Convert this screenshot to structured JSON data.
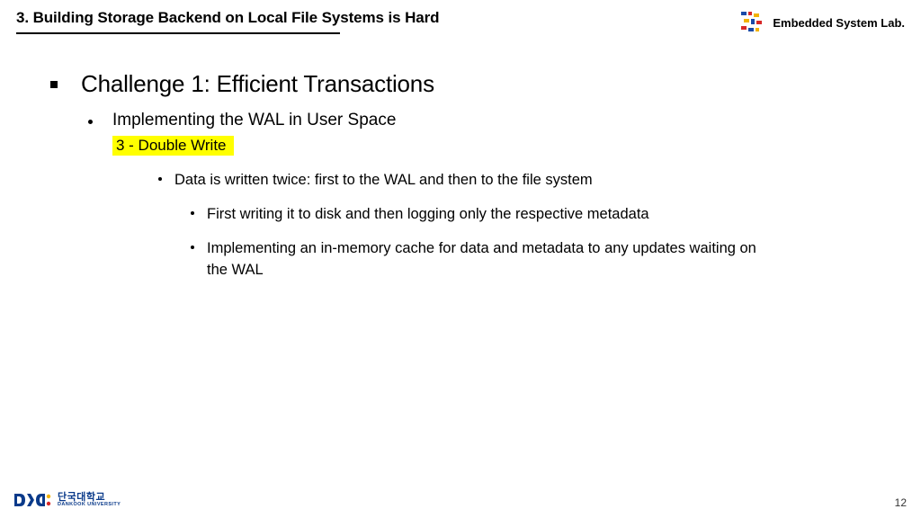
{
  "header": {
    "section_title": "3. Building Storage Backend on Local File Systems is Hard",
    "lab_name": "Embedded System Lab."
  },
  "content": {
    "h1": "Challenge 1: Efficient Transactions",
    "h2": "Implementing the WAL in User Space",
    "highlight": "3 - Double Write",
    "p1": "Data is written twice: first to the WAL and then to the file system",
    "p2": "First writing it to disk and then logging only the respective metadata",
    "p3": "Implementing an in-memory cache for data and metadata to any updates waiting on the WAL"
  },
  "footer": {
    "uni_kr": "단국대학교",
    "uni_en": "DANKOOK UNIVERSITY",
    "page": "12"
  }
}
